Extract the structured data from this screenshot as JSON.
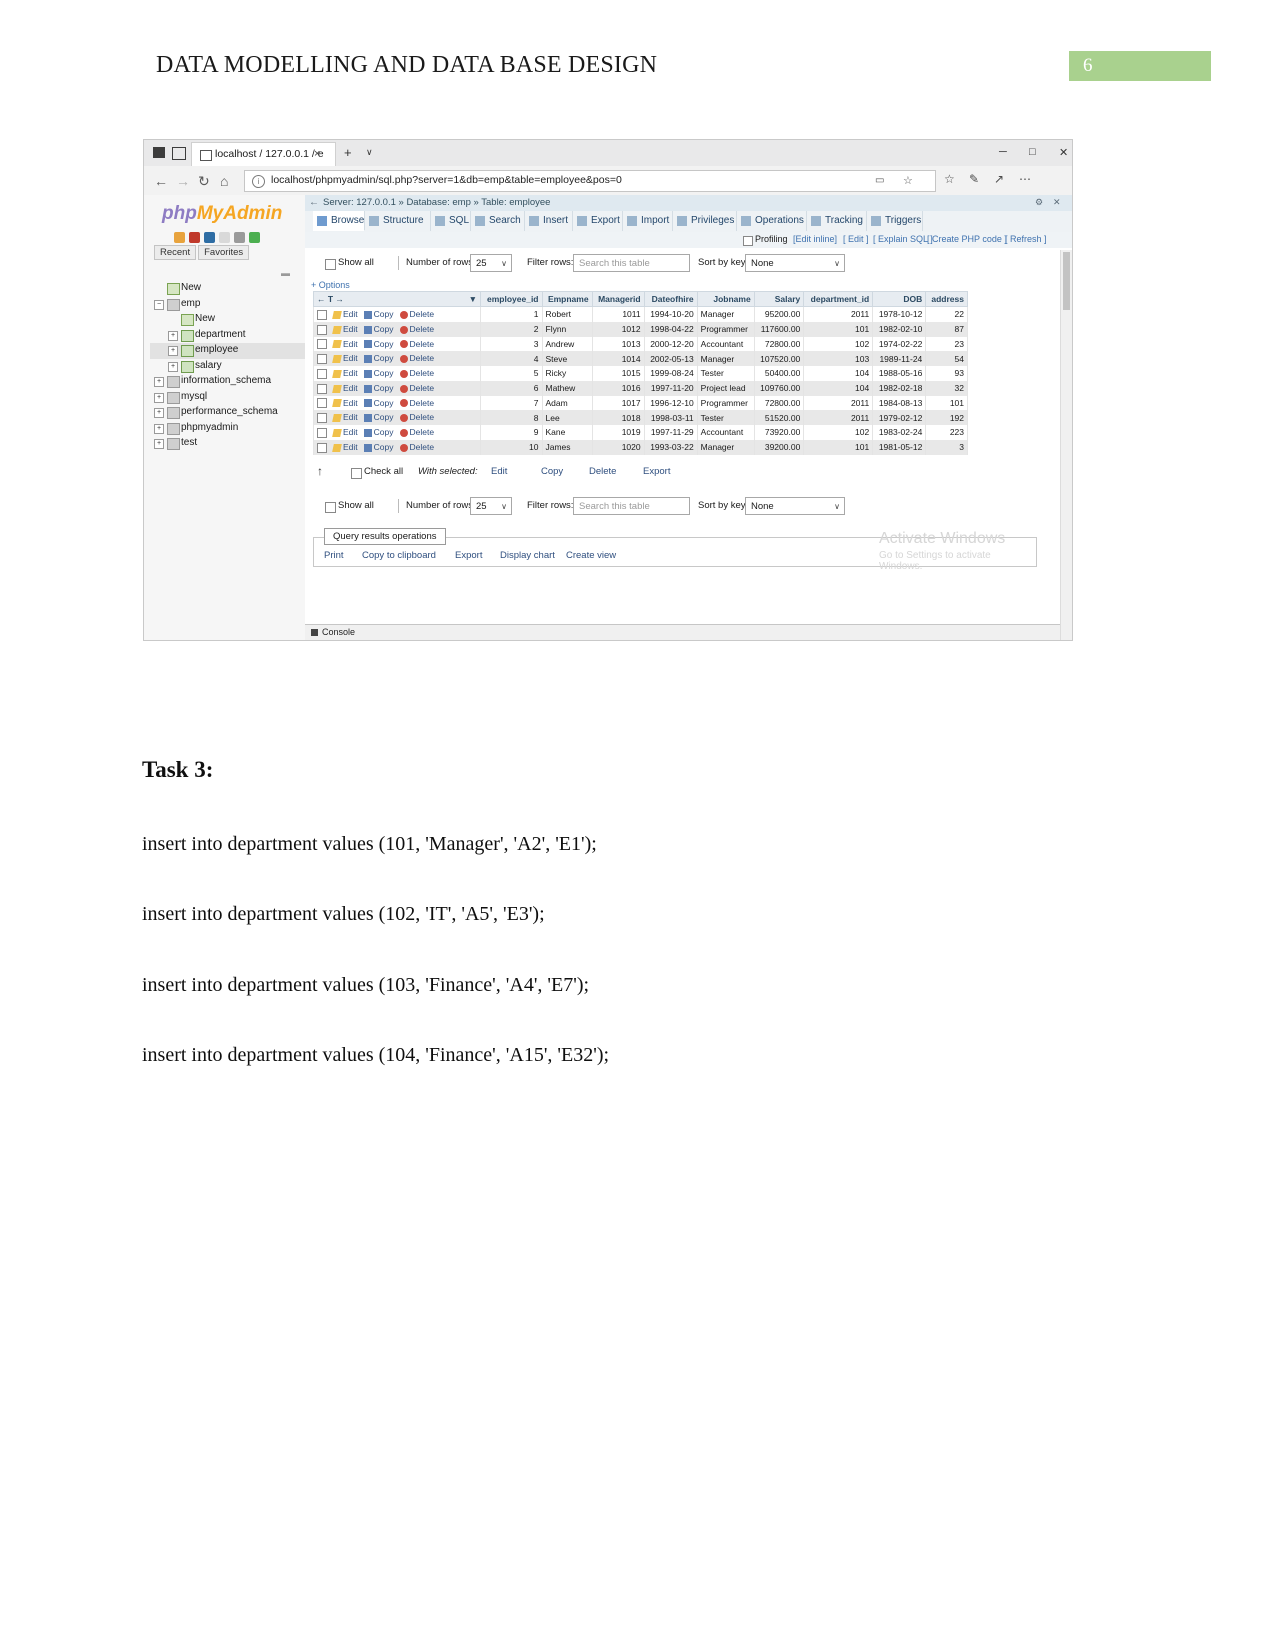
{
  "document": {
    "header_title": "DATA MODELLING AND DATA BASE DESIGN",
    "page_number": "6"
  },
  "browser": {
    "tab_title": "localhost / 127.0.0.1 / e",
    "tab_close": "×",
    "new_tab": "+",
    "tab_list_caret": "∨",
    "window_minimize": "─",
    "window_maximize": "□",
    "window_close": "✕",
    "back": "←",
    "forward": "→",
    "reload": "↻",
    "home": "⌂",
    "url": "localhost/phpmyadmin/sql.php?server=1&db=emp&table=employee&pos=0",
    "info_icon": "i",
    "reading_view": "▭",
    "favorite": "☆",
    "favorites_bar": "☆",
    "notes": "✎",
    "share": "↗",
    "settings": "⋯"
  },
  "phpmyadmin": {
    "logo_part1": "php",
    "logo_part2": "MyAdmin",
    "recent": "Recent",
    "favorites": "Favorites",
    "dots": "▬",
    "tree": [
      {
        "label": "New",
        "depth": 0,
        "toggle": "",
        "icon": "new-icon"
      },
      {
        "label": "emp",
        "depth": 0,
        "toggle": "−",
        "icon": "db-icon"
      },
      {
        "label": "New",
        "depth": 1,
        "toggle": "",
        "icon": "new-icon"
      },
      {
        "label": "department",
        "depth": 1,
        "toggle": "+",
        "icon": "table-icon"
      },
      {
        "label": "employee",
        "depth": 1,
        "toggle": "+",
        "icon": "table-icon",
        "selected": true
      },
      {
        "label": "salary",
        "depth": 1,
        "toggle": "+",
        "icon": "table-icon"
      },
      {
        "label": "information_schema",
        "depth": 0,
        "toggle": "+",
        "icon": "db-icon"
      },
      {
        "label": "mysql",
        "depth": 0,
        "toggle": "+",
        "icon": "db-icon"
      },
      {
        "label": "performance_schema",
        "depth": 0,
        "toggle": "+",
        "icon": "db-icon"
      },
      {
        "label": "phpmyadmin",
        "depth": 0,
        "toggle": "+",
        "icon": "db-icon"
      },
      {
        "label": "test",
        "depth": 0,
        "toggle": "+",
        "icon": "db-icon"
      }
    ],
    "breadcrumb": "Server: 127.0.0.1 »  Database: emp »  Table: employee",
    "breadcrumb_back": "←",
    "breadcrumb_settings": "⚙",
    "breadcrumb_close": "✕",
    "tabs": [
      {
        "label": "Browse",
        "active": true
      },
      {
        "label": "Structure",
        "active": false
      },
      {
        "label": "SQL",
        "active": false
      },
      {
        "label": "Search",
        "active": false
      },
      {
        "label": "Insert",
        "active": false
      },
      {
        "label": "Export",
        "active": false
      },
      {
        "label": "Import",
        "active": false
      },
      {
        "label": "Privileges",
        "active": false
      },
      {
        "label": "Operations",
        "active": false
      },
      {
        "label": "Tracking",
        "active": false
      },
      {
        "label": "Triggers",
        "active": false
      }
    ],
    "profiling": {
      "label": "Profiling",
      "links": [
        "[Edit inline]",
        "[ Edit ]",
        "[ Explain SQL ]",
        "[ Create PHP code ]",
        "[ Refresh ]"
      ]
    },
    "controls": {
      "show_all": "Show all",
      "number_of_rows_label": "Number of rows:",
      "number_of_rows_value": "25",
      "filter_rows_label": "Filter rows:",
      "filter_rows_placeholder": "Search this table",
      "sort_by_key_label": "Sort by key:",
      "sort_by_key_value": "None",
      "options": "+ Options",
      "dropdown_caret": "∨"
    },
    "table": {
      "action_sort_caret": "▼",
      "nav_arrows": "← T →",
      "row_actions": [
        "Edit",
        "Copy",
        "Delete"
      ],
      "columns": [
        "employee_id",
        "Empname",
        "Managerid",
        "Dateofhire",
        "Jobname",
        "Salary",
        "department_id",
        "DOB",
        "address"
      ],
      "rows": [
        {
          "employee_id": "1",
          "Empname": "Robert",
          "Managerid": "1011",
          "Dateofhire": "1994-10-20",
          "Jobname": "Manager",
          "Salary": "95200.00",
          "department_id": "2011",
          "DOB": "1978-10-12",
          "address": "22"
        },
        {
          "employee_id": "2",
          "Empname": "Flynn",
          "Managerid": "1012",
          "Dateofhire": "1998-04-22",
          "Jobname": "Programmer",
          "Salary": "117600.00",
          "department_id": "101",
          "DOB": "1982-02-10",
          "address": "87"
        },
        {
          "employee_id": "3",
          "Empname": "Andrew",
          "Managerid": "1013",
          "Dateofhire": "2000-12-20",
          "Jobname": "Accountant",
          "Salary": "72800.00",
          "department_id": "102",
          "DOB": "1974-02-22",
          "address": "23"
        },
        {
          "employee_id": "4",
          "Empname": "Steve",
          "Managerid": "1014",
          "Dateofhire": "2002-05-13",
          "Jobname": "Manager",
          "Salary": "107520.00",
          "department_id": "103",
          "DOB": "1989-11-24",
          "address": "54"
        },
        {
          "employee_id": "5",
          "Empname": "Ricky",
          "Managerid": "1015",
          "Dateofhire": "1999-08-24",
          "Jobname": "Tester",
          "Salary": "50400.00",
          "department_id": "104",
          "DOB": "1988-05-16",
          "address": "93"
        },
        {
          "employee_id": "6",
          "Empname": "Mathew",
          "Managerid": "1016",
          "Dateofhire": "1997-11-20",
          "Jobname": "Project lead",
          "Salary": "109760.00",
          "department_id": "104",
          "DOB": "1982-02-18",
          "address": "32"
        },
        {
          "employee_id": "7",
          "Empname": "Adam",
          "Managerid": "1017",
          "Dateofhire": "1996-12-10",
          "Jobname": "Programmer",
          "Salary": "72800.00",
          "department_id": "2011",
          "DOB": "1984-08-13",
          "address": "101"
        },
        {
          "employee_id": "8",
          "Empname": "Lee",
          "Managerid": "1018",
          "Dateofhire": "1998-03-11",
          "Jobname": "Tester",
          "Salary": "51520.00",
          "department_id": "2011",
          "DOB": "1979-02-12",
          "address": "192"
        },
        {
          "employee_id": "9",
          "Empname": "Kane",
          "Managerid": "1019",
          "Dateofhire": "1997-11-29",
          "Jobname": "Accountant",
          "Salary": "73920.00",
          "department_id": "102",
          "DOB": "1983-02-24",
          "address": "223"
        },
        {
          "employee_id": "10",
          "Empname": "James",
          "Managerid": "1020",
          "Dateofhire": "1993-03-22",
          "Jobname": "Manager",
          "Salary": "39200.00",
          "department_id": "101",
          "DOB": "1981-05-12",
          "address": "3"
        }
      ]
    },
    "selection_bar": {
      "arrow": "↑",
      "check_all": "Check all",
      "with_selected": "With selected:",
      "actions": [
        "Edit",
        "Copy",
        "Delete",
        "Export"
      ]
    },
    "query_results_operations": {
      "legend": "Query results operations",
      "items": [
        "Print",
        "Copy to clipboard",
        "Export",
        "Display chart",
        "Create view"
      ]
    },
    "console": "Console",
    "watermark_line1": "Activate Windows",
    "watermark_line2": "Go to Settings to activate Windows."
  },
  "task": {
    "heading": "Task 3:",
    "statements": [
      "insert into department values (101, 'Manager', 'A2', 'E1');",
      "insert into department values (102, 'IT', 'A5', 'E3');",
      "insert into department values (103, 'Finance', 'A4', 'E7');",
      "insert into department values (104, 'Finance', 'A15', 'E32');"
    ]
  }
}
